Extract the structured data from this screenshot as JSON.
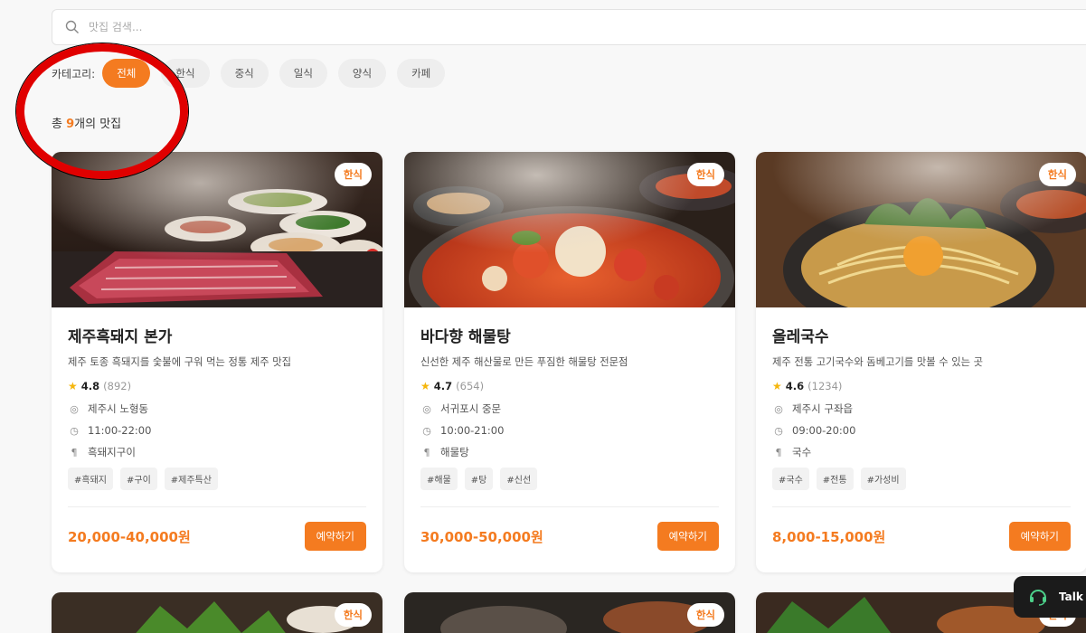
{
  "search": {
    "placeholder": "맛집 검색..."
  },
  "categories": {
    "label": "카테고리:",
    "items": [
      "전체",
      "한식",
      "중식",
      "일식",
      "양식",
      "카페"
    ],
    "active": "전체"
  },
  "result_count": {
    "prefix": "총 ",
    "count": "9",
    "suffix": "개의 맛집"
  },
  "restaurants": [
    {
      "badge": "한식",
      "name": "제주흑돼지 본가",
      "description": "제주 토종 흑돼지를 숯불에 구워 먹는 정통 제주 맛집",
      "rating": "4.8",
      "reviews": "(892)",
      "location": "제주시 노형동",
      "hours": "11:00-22:00",
      "menu": "흑돼지구이",
      "tags": [
        "#흑돼지",
        "#구이",
        "#제주특산"
      ],
      "price": "20,000-40,000원",
      "reserve_label": "예약하기"
    },
    {
      "badge": "한식",
      "name": "바다향 해물탕",
      "description": "신선한 제주 해산물로 만든 푸짐한 해물탕 전문점",
      "rating": "4.7",
      "reviews": "(654)",
      "location": "서귀포시 중문",
      "hours": "10:00-21:00",
      "menu": "해물탕",
      "tags": [
        "#해물",
        "#탕",
        "#신선"
      ],
      "price": "30,000-50,000원",
      "reserve_label": "예약하기"
    },
    {
      "badge": "한식",
      "name": "올레국수",
      "description": "제주 전통 고기국수와 돔베고기를 맛볼 수 있는 곳",
      "rating": "4.6",
      "reviews": "(1234)",
      "location": "제주시 구좌읍",
      "hours": "09:00-20:00",
      "menu": "국수",
      "tags": [
        "#국수",
        "#전통",
        "#가성비"
      ],
      "price": "8,000-15,000원",
      "reserve_label": "예약하기"
    }
  ],
  "next_row_badges": [
    "한식",
    "한식",
    "한식"
  ],
  "talk": {
    "label": "Talk"
  },
  "colors": {
    "accent": "#f47b20",
    "star": "#f5b60c",
    "annotation": "#e00000"
  }
}
